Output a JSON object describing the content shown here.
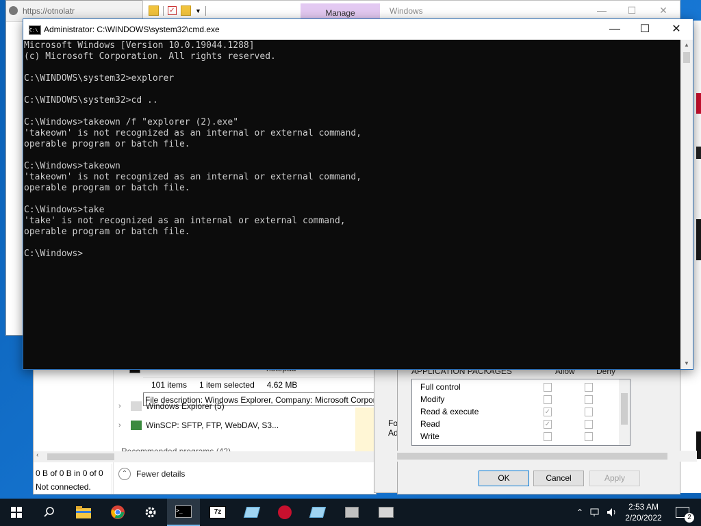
{
  "browser": {
    "url": "https://otnolatr"
  },
  "explorer_ribbon": {
    "manage_tab": "Manage",
    "title": "Windows"
  },
  "explorer": {
    "items": [
      {
        "label": "Windows Explorer (5)"
      },
      {
        "label": "WinSCP: SFTP, FTP, WebDAV, S3..."
      }
    ],
    "partial_item": "notepad",
    "partial_group": "Recommended programs (42)",
    "status": {
      "count": "101 items",
      "selected": "1 item selected",
      "size": "4.62 MB"
    },
    "tooltip": "File description: Windows Explorer, Company: Microsoft Corporation",
    "left_status": {
      "line1": "0 B of 0 B in 0 of 0",
      "line2": "Not connected."
    },
    "fewer_details": "Fewer details"
  },
  "properties": {
    "left_fragment_1": "For",
    "left_fragment_2": "Ad",
    "header": {
      "principal": "APPLICATION PACKAGES",
      "allow": "Allow",
      "deny": "Deny"
    },
    "permissions": [
      {
        "name": "Full control",
        "allow": false,
        "deny": false
      },
      {
        "name": "Modify",
        "allow": false,
        "deny": false
      },
      {
        "name": "Read & execute",
        "allow": true,
        "deny": false
      },
      {
        "name": "Read",
        "allow": true,
        "deny": false
      },
      {
        "name": "Write",
        "allow": false,
        "deny": false
      }
    ],
    "buttons": {
      "ok": "OK",
      "cancel": "Cancel",
      "apply": "Apply"
    }
  },
  "cmd": {
    "title": "Administrator: C:\\WINDOWS\\system32\\cmd.exe",
    "output": "Microsoft Windows [Version 10.0.19044.1288]\n(c) Microsoft Corporation. All rights reserved.\n\nC:\\WINDOWS\\system32>explorer\n\nC:\\WINDOWS\\system32>cd ..\n\nC:\\Windows>takeown /f \"explorer (2).exe\"\n'takeown' is not recognized as an internal or external command,\noperable program or batch file.\n\nC:\\Windows>takeown\n'takeown' is not recognized as an internal or external command,\noperable program or batch file.\n\nC:\\Windows>take\n'take' is not recognized as an internal or external command,\noperable program or batch file.\n\nC:\\Windows>"
  },
  "taskbar": {
    "apps": [
      "start-icon",
      "search-icon",
      "file-explorer-icon",
      "chrome-icon",
      "settings-icon",
      "cmd-icon",
      "7zip-icon",
      "app-icon-1",
      "app-icon-red",
      "app-icon-2",
      "app-icon-lock",
      "app-icon-3"
    ],
    "time": "2:53 AM",
    "date": "2/20/2022",
    "notifications": "2"
  },
  "colors": {
    "console_bg": "#0c0c0c",
    "console_fg": "#cccccc",
    "taskbar": "#0e1822",
    "desktop": "#1777d4"
  }
}
